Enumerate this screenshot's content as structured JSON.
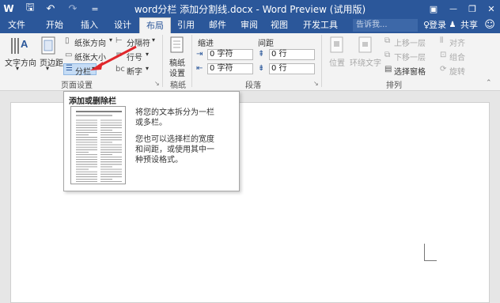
{
  "titlebar": {
    "title": "word分栏 添加分割线.docx - Word Preview (试用版)",
    "icons": [
      "save-icon",
      "undo-icon",
      "redo-icon",
      "customize-icon",
      "ribbon-display-icon",
      "minimize-icon",
      "restore-icon",
      "close-icon"
    ],
    "word_glyph": "W",
    "save_glyph": "🖫",
    "undo_glyph": "↶",
    "redo_glyph": "↷",
    "customize_glyph": "=",
    "ribbon_glyph": "▣",
    "min_glyph": "—",
    "restore_glyph": "❐",
    "close_glyph": "✕"
  },
  "tabs": [
    "文件",
    "开始",
    "插入",
    "设计",
    "布局",
    "引用",
    "邮件",
    "审阅",
    "视图",
    "开发工具"
  ],
  "active_tab": "布局",
  "tell_me": {
    "placeholder": "告诉我...",
    "bulb": "♀"
  },
  "account": {
    "signin": "登录",
    "share": "共享",
    "smiley": "☺"
  },
  "ribbon": {
    "page_setup": {
      "label": "页面设置",
      "text_direction": "文字方向",
      "margins": "页边距",
      "orientation": "纸张方向",
      "size": "纸张大小",
      "columns": "分栏",
      "breaks": "分隔符",
      "line_numbers": "行号",
      "hyphenation": "断字"
    },
    "draft": {
      "label": "稿纸",
      "settings_line1": "稿纸",
      "settings_line2": "设置"
    },
    "paragraph": {
      "label": "段落",
      "indent": "缩进",
      "spacing": "间距",
      "indent_left": "0 字符",
      "indent_right": "0 字符",
      "spacing_before": "0 行",
      "spacing_after": "0 行"
    },
    "arrange": {
      "label": "排列",
      "position": "位置",
      "wrap_text": "环绕文字",
      "bring_forward": "上移一层",
      "send_backward": "下移一层",
      "selection_pane": "选择窗格",
      "align": "对齐",
      "group": "组合",
      "rotate": "旋转"
    }
  },
  "tooltip": {
    "title": "添加或删除栏",
    "desc1_line1": "将您的文本拆分为一栏",
    "desc1_line2": "或多栏。",
    "desc2_line1": "您也可以选择栏的宽度",
    "desc2_line2": "和间距，或使用其中一",
    "desc2_line3": "种预设格式。"
  },
  "colors": {
    "word_blue": "#2b579a",
    "ribbon_bg": "#f3f3f3",
    "arrow_red": "#e0262b",
    "highlight": "#c5dcf5"
  }
}
